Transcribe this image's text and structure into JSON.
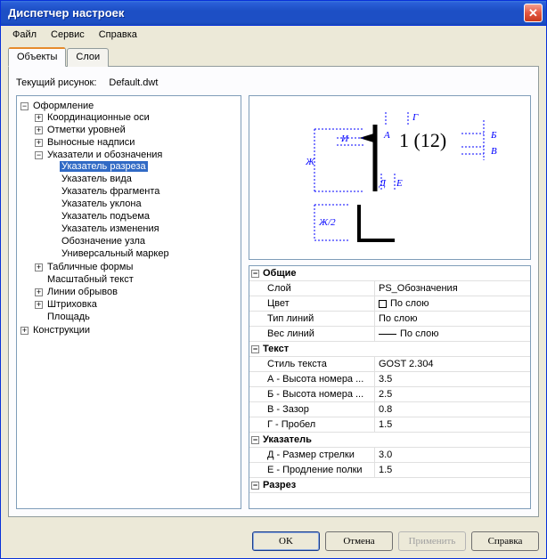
{
  "window": {
    "title": "Диспетчер настроек"
  },
  "menu": {
    "file": "Файл",
    "tools": "Сервис",
    "help": "Справка"
  },
  "tabs": {
    "objects": "Объекты",
    "layers": "Слои"
  },
  "current": {
    "label": "Текущий рисунок:",
    "value": "Default.dwt"
  },
  "tree": {
    "root1": "Оформление",
    "sub1": "Координационные оси",
    "sub2": "Отметки уровней",
    "sub3": "Выносные надписи",
    "sub4": "Указатели и обозначения",
    "sub4a": "Указатель разреза",
    "sub4b": "Указатель вида",
    "sub4c": "Указатель фрагмента",
    "sub4d": "Указатель уклона",
    "sub4e": "Указатель подъема",
    "sub4f": "Указатель изменения",
    "sub4g": "Обозначение узла",
    "sub4h": "Универсальный маркер",
    "sub5": "Табличные формы",
    "sub6": "Масштабный текст",
    "sub7": "Линии обрывов",
    "sub8": "Штриховка",
    "sub9": "Площадь",
    "root2": "Конструкции"
  },
  "preview": {
    "labels": {
      "A": "А",
      "B": "Б",
      "V": "В",
      "G": "Г",
      "D": "Д",
      "E": "Е",
      "ZH": "Ж",
      "I": "И",
      "ZH2": "Ж/2",
      "ann": "1 (12)"
    }
  },
  "props": {
    "g_general": "Общие",
    "layer_n": "Слой",
    "layer_v": "PS_Обозначения",
    "color_n": "Цвет",
    "color_v": "По слою",
    "ltype_n": "Тип линий",
    "ltype_v": "По слою",
    "lweight_n": "Вес линий",
    "lweight_v": "По слою",
    "g_text": "Текст",
    "tstyle_n": "Стиль текста",
    "tstyle_v": "GOST 2.304",
    "a_n": "А - Высота номера ...",
    "a_v": "3.5",
    "b_n": "Б - Высота номера ...",
    "b_v": "2.5",
    "v_n": "В - Зазор",
    "v_v": "0.8",
    "g_n": "Г - Пробел",
    "g_v": "1.5",
    "g_pointer": "Указатель",
    "d_n": "Д - Размер стрелки",
    "d_v": "3.0",
    "e_n": "Е - Продление полки",
    "e_v": "1.5",
    "g_section": "Разрез"
  },
  "buttons": {
    "ok": "OK",
    "cancel": "Отмена",
    "apply": "Применить",
    "help": "Справка"
  },
  "glyphs": {
    "minus": "−",
    "plus": "+"
  }
}
